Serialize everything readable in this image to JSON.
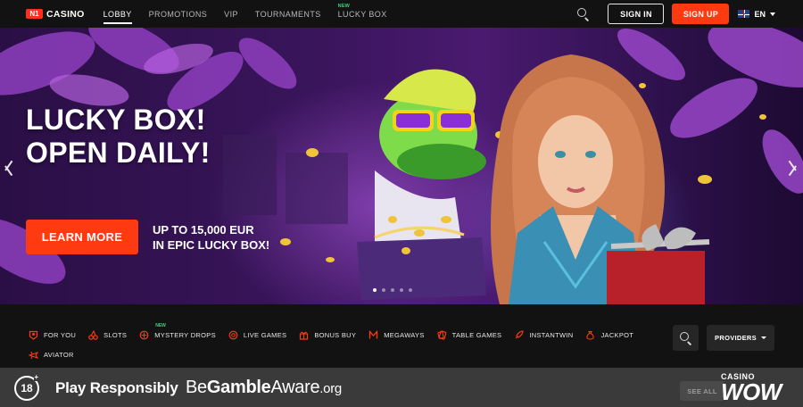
{
  "header": {
    "logo_mark": "N1",
    "logo_text": "CASINO",
    "nav": [
      {
        "label": "LOBBY",
        "active": true
      },
      {
        "label": "PROMOTIONS",
        "active": false
      },
      {
        "label": "VIP",
        "active": false
      },
      {
        "label": "TOURNAMENTS",
        "active": false
      },
      {
        "label": "LUCKY BOX",
        "active": false,
        "badge": "NEW"
      }
    ],
    "signin_label": "SIGN IN",
    "signup_label": "SIGN UP",
    "language": "EN"
  },
  "hero": {
    "title_line1": "LUCKY BOX!",
    "title_line2": "OPEN DAILY!",
    "cta_label": "LEARN MORE",
    "promo_line1": "UP TO 15,000 EUR",
    "promo_line2": "IN EPIC LUCKY BOX!",
    "slides_total": 5,
    "slide_active": 1
  },
  "categories": {
    "items": [
      {
        "label": "FOR YOU",
        "icon": "user-icon"
      },
      {
        "label": "SLOTS",
        "icon": "cherries-icon"
      },
      {
        "label": "MYSTERY DROPS",
        "icon": "target-icon",
        "badge": "NEW"
      },
      {
        "label": "LIVE GAMES",
        "icon": "chip-icon"
      },
      {
        "label": "BONUS BUY",
        "icon": "gift-icon"
      },
      {
        "label": "MEGAWAYS",
        "icon": "megaways-icon"
      },
      {
        "label": "TABLE GAMES",
        "icon": "cards-icon"
      },
      {
        "label": "INSTANTWIN",
        "icon": "rocket-icon"
      },
      {
        "label": "JACKPOT",
        "icon": "money-bag-icon"
      },
      {
        "label": "AVIATOR",
        "icon": "plane-icon"
      }
    ],
    "providers_label": "PROVIDERS"
  },
  "bottom": {
    "age_badge": "18",
    "age_plus": "+",
    "play_responsibly": "Play Responsibly",
    "bga_be": "Be",
    "bga_gamble": "Gamble",
    "bga_aware": "Aware",
    "bga_org": ".org",
    "see_all": "SEE ALL",
    "watermark_top": "CASINO",
    "watermark_main": "WOW"
  },
  "colors": {
    "accent": "#ff3a10",
    "new_badge": "#3fd27b",
    "category_icon": "#ff3a10"
  }
}
